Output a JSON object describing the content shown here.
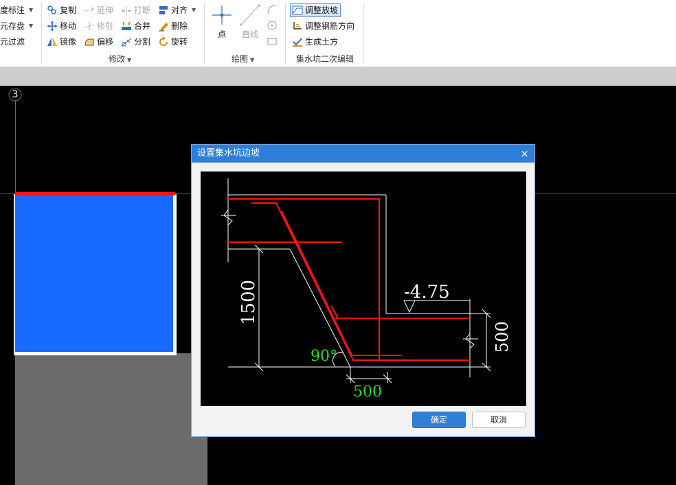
{
  "ribbon": {
    "left_cut": [
      {
        "label": "度标注",
        "caret": true
      },
      {
        "label": "元存盘",
        "caret": true
      },
      {
        "label": "元过滤",
        "caret": false
      }
    ],
    "modify": {
      "items": {
        "copy": "复制",
        "extend": "延伸",
        "break": "打断",
        "align": "对齐",
        "move": "移动",
        "trim": "修剪",
        "merge": "合并",
        "delete": "删除",
        "mirror": "镜像",
        "offset": "偏移",
        "split": "分割",
        "rotate": "旋转"
      },
      "label": "修改"
    },
    "draw": {
      "point": "点",
      "line": "直线",
      "label": "绘图"
    },
    "pit": {
      "adjust_slope": "调整放坡",
      "adjust_rebar": "调整钢筋方向",
      "gen_earth": "生成土方",
      "label": "集水坑二次编辑"
    }
  },
  "canvas": {
    "axis_number": "3"
  },
  "dialog": {
    "title": "设置集水坑边坡",
    "close": "×",
    "diagram": {
      "elevation": "-4.75",
      "depth": "1500",
      "angle": "90°",
      "width": "500",
      "height": "500"
    },
    "ok": "确定",
    "cancel": "取消"
  },
  "colors": {
    "accent": "#2f7fd8",
    "rebar": "#ff1212",
    "pit_fill": "#1769ff",
    "dim_green": "#22e022"
  }
}
